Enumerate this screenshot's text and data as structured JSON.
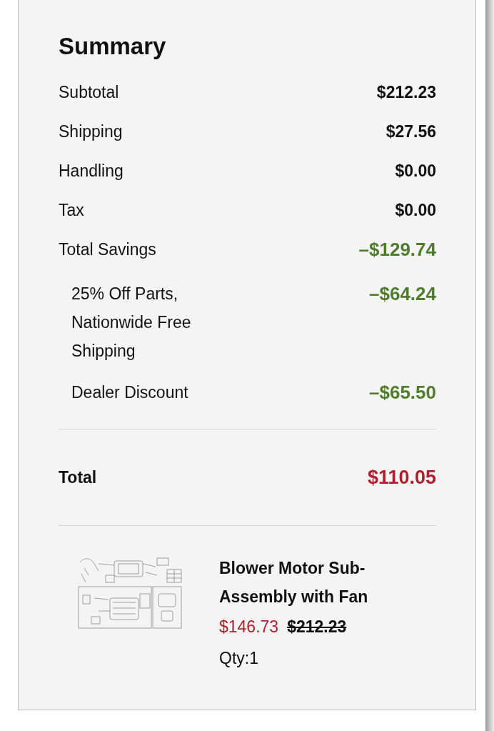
{
  "summary": {
    "title": "Summary",
    "rows": [
      {
        "label": "Subtotal",
        "value": "$212.23",
        "kind": "charge"
      },
      {
        "label": "Shipping",
        "value": "$27.56",
        "kind": "charge"
      },
      {
        "label": "Handling",
        "value": "$0.00",
        "kind": "charge"
      },
      {
        "label": "Tax",
        "value": "$0.00",
        "kind": "charge"
      },
      {
        "label": "Total Savings",
        "value": "–$129.74",
        "kind": "savings"
      }
    ],
    "savings_details": [
      {
        "label": "25% Off Parts, Nationwide Free Shipping",
        "value": "–$64.24"
      },
      {
        "label": "Dealer Discount",
        "value": "–$65.50"
      }
    ],
    "total": {
      "label": "Total",
      "value": "$110.05"
    }
  },
  "item": {
    "name": "Blower Motor Sub-Assembly with Fan",
    "sale_price": "$146.73",
    "original_price": "$212.23",
    "quantity": "Qty:1"
  }
}
